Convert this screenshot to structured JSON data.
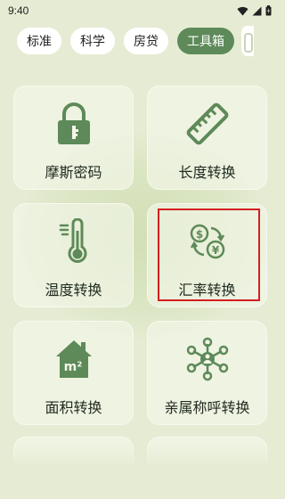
{
  "status": {
    "time": "9:40"
  },
  "tabs": [
    {
      "label": "标准",
      "active": false
    },
    {
      "label": "科学",
      "active": false
    },
    {
      "label": "房贷",
      "active": false
    },
    {
      "label": "工具箱",
      "active": true
    }
  ],
  "tools": [
    {
      "label": "摩斯密码",
      "icon": "lock-icon"
    },
    {
      "label": "长度转换",
      "icon": "ruler-icon"
    },
    {
      "label": "温度转换",
      "icon": "thermometer-icon"
    },
    {
      "label": "汇率转换",
      "icon": "currency-exchange-icon"
    },
    {
      "label": "面积转换",
      "icon": "house-area-icon"
    },
    {
      "label": "亲属称呼转换",
      "icon": "family-network-icon"
    }
  ],
  "icon_labels": {
    "area_unit": "m²"
  },
  "colors": {
    "accent": "#5d8a58",
    "background": "#e6ecd4",
    "highlight": "#d41f1f"
  }
}
